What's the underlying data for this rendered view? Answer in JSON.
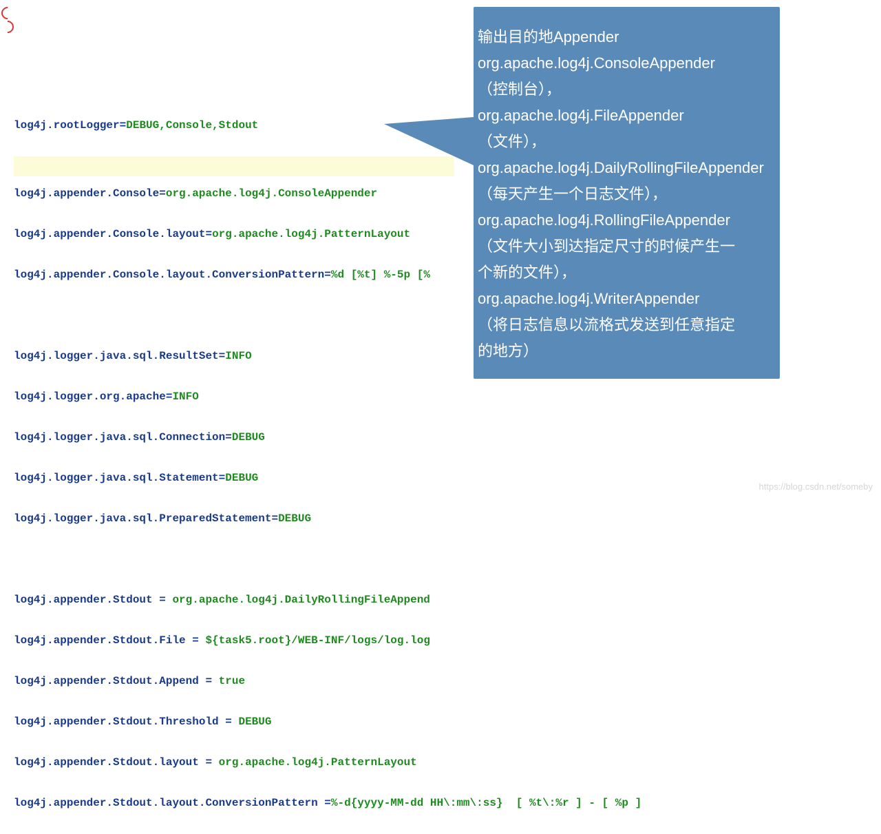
{
  "code": {
    "l1_key": "log4j.rootLogger",
    "l1_val": "DEBUG,Console,Stdout",
    "l3_key": "log4j.appender.Console",
    "l3_val": "org.apache.log4j.ConsoleAppender",
    "l4_key": "log4j.appender.Console.layout",
    "l4_val": "org.apache.log4j.PatternLayout",
    "l5_key": "log4j.appender.Console.layout.ConversionPattern",
    "l5_val": "%d [%t] %-5p [%",
    "l7_key": "log4j.logger.java.sql.ResultSet",
    "l7_val": "INFO",
    "l8_key": "log4j.logger.org.apache",
    "l8_val": "INFO",
    "l9_key": "log4j.logger.java.sql.Connection",
    "l9_val": "DEBUG",
    "l10_key": "log4j.logger.java.sql.Statement",
    "l10_val": "DEBUG",
    "l11_key": "log4j.logger.java.sql.PreparedStatement",
    "l11_val": "DEBUG",
    "l13_key": "log4j.appender.Stdout ",
    "l13_val": " org.apache.log4j.DailyRollingFileAppend",
    "l14_key": "log4j.appender.Stdout.File ",
    "l14_val": " ${task5.root}/WEB-INF/logs/log.log",
    "l15_key": "log4j.appender.Stdout.Append ",
    "l15_val": " true",
    "l16_key": "log4j.appender.Stdout.Threshold ",
    "l16_val": " DEBUG",
    "l17_key": "log4j.appender.Stdout.layout ",
    "l17_val": " org.apache.log4j.PatternLayout",
    "l18_key": "log4j.appender.Stdout.layout.ConversionPattern ",
    "l18_val": "%-d{yyyy-MM-dd HH\\:mm\\:ss}  [ %t\\:%r ] - [ %p ]"
  },
  "callout": {
    "line1": "输出目的地Appender",
    "line2": "org.apache.log4j.ConsoleAppender",
    "line3": "（控制台），",
    "line4": "org.apache.log4j.FileAppender",
    "line5": "（文件），",
    "line6": "org.apache.log4j.DailyRollingFileAppender",
    "line7": "（每天产生一个日志文件），",
    "line8": "org.apache.log4j.RollingFileAppender",
    "line9": "（文件大小到达指定尺寸的时候产生一",
    "line10": "个新的文件），",
    "line11": "org.apache.log4j.WriterAppender",
    "line12": "（将日志信息以流格式发送到任意指定",
    "line13": "的地方）"
  },
  "watermark": "https://blog.csdn.net/someby"
}
